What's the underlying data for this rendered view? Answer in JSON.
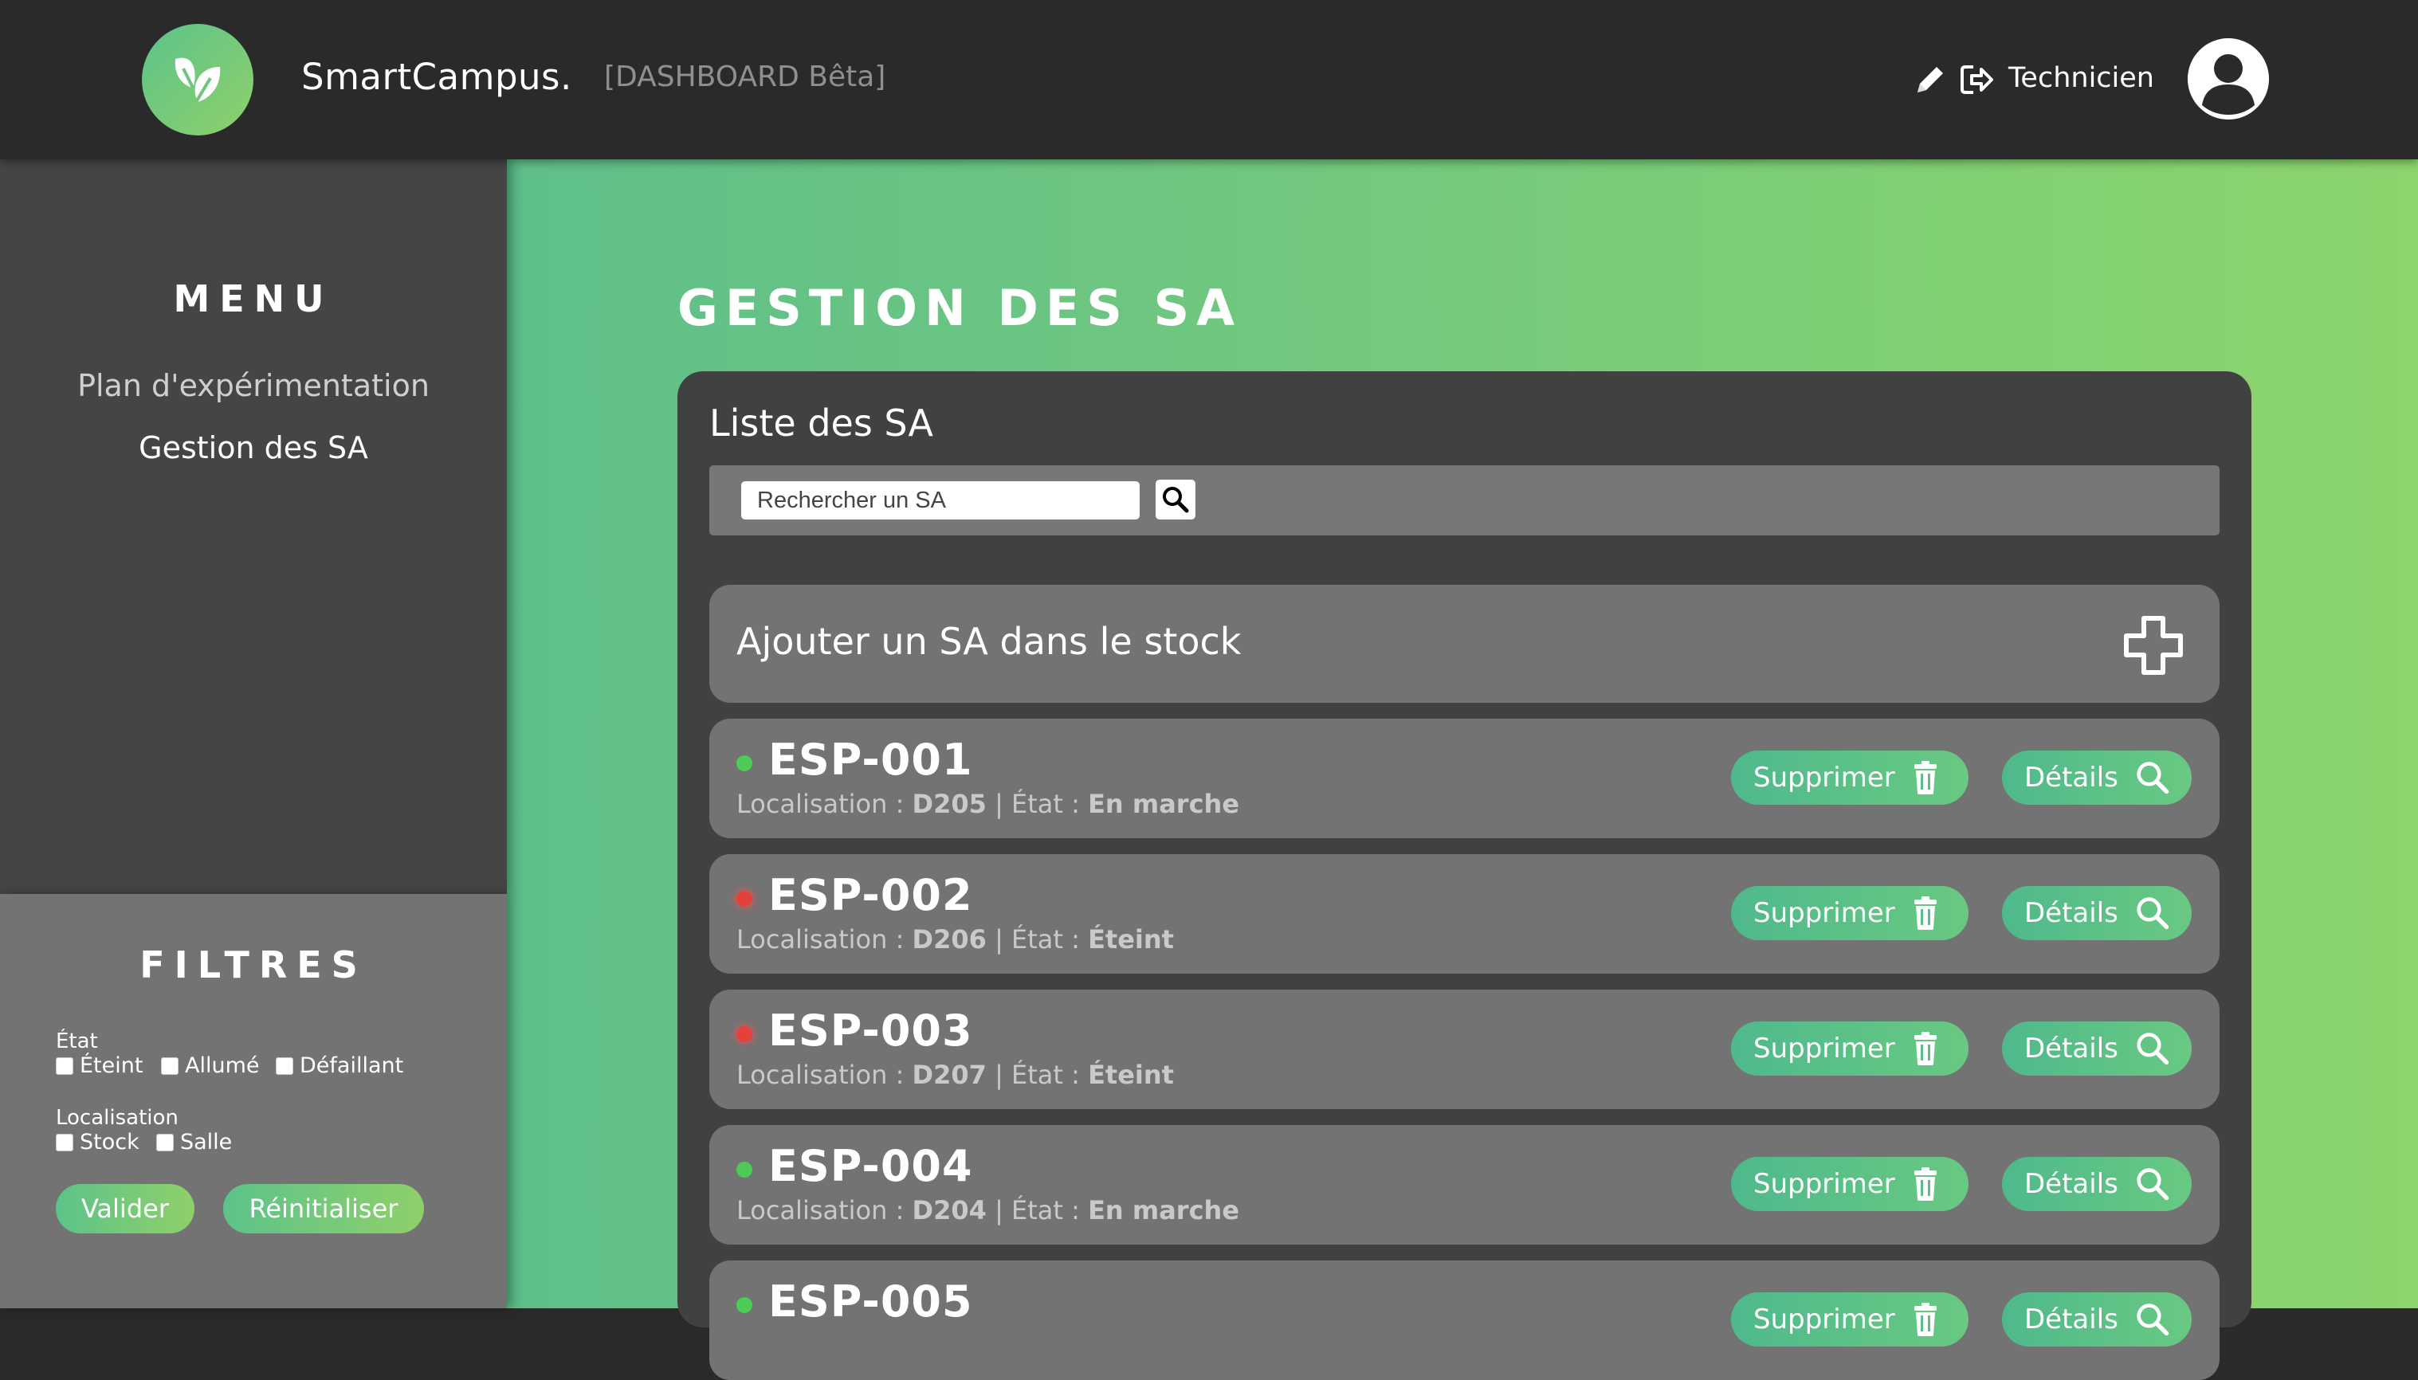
{
  "header": {
    "brand": "SmartCampus.",
    "subtitle": "[DASHBOARD Bêta]",
    "role": "Technicien",
    "icons": [
      "leaf-logo-icon",
      "pencil-icon",
      "logout-icon",
      "user-avatar-icon"
    ]
  },
  "sidebar": {
    "menu_title": "MENU",
    "items": [
      {
        "label": "Plan d'expérimentation"
      },
      {
        "label": "Gestion des SA"
      }
    ],
    "filters": {
      "title": "FILTRES",
      "state_label": "État",
      "state_options": [
        "Éteint",
        "Allumé",
        "Défaillant"
      ],
      "location_label": "Localisation",
      "location_options": [
        "Stock",
        "Salle"
      ],
      "submit_label": "Valider",
      "reset_label": "Réinitialiser"
    }
  },
  "main": {
    "page_title": "GESTION DES SA",
    "panel_title": "Liste des SA",
    "search_placeholder": "Rechercher un SA",
    "add_label": "Ajouter un SA dans le stock",
    "location_prefix": "Localisation :",
    "state_prefix": "État :",
    "delete_label": "Supprimer",
    "details_label": "Détails",
    "sa_list": [
      {
        "name": "ESP-001",
        "location": "D205",
        "state": "En marche",
        "status_color": "#4ccb56"
      },
      {
        "name": "ESP-002",
        "location": "D206",
        "state": "Éteint",
        "status_color": "#e4413a"
      },
      {
        "name": "ESP-003",
        "location": "D207",
        "state": "Éteint",
        "status_color": "#e4413a"
      },
      {
        "name": "ESP-004",
        "location": "D204",
        "state": "En marche",
        "status_color": "#4ccb56"
      },
      {
        "name": "ESP-005",
        "status_color": "#4ccb56"
      }
    ]
  },
  "colors": {
    "header_bg": "#2a2a2a",
    "sidebar_bg": "#454545",
    "filters_bg": "#737373",
    "panel_bg": "#414141",
    "card_bg": "#737373",
    "accent_gradient_start": "#5cc38a",
    "accent_gradient_end": "#8fd06a"
  }
}
